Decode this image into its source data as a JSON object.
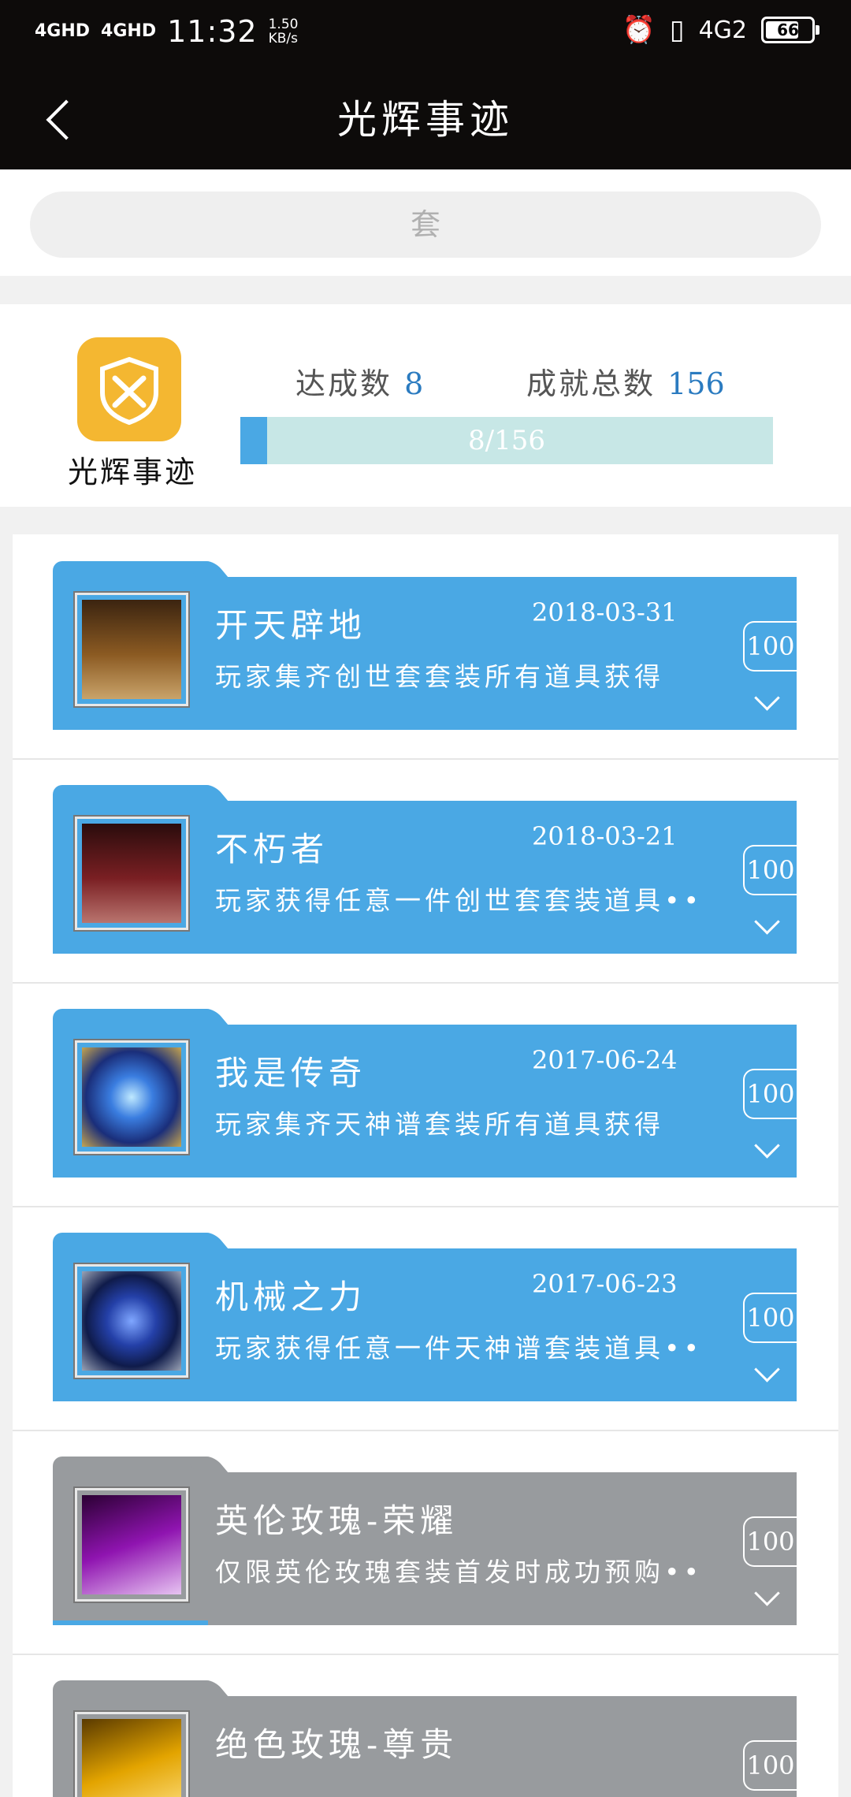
{
  "status_bar": {
    "signal1": "4GHD",
    "signal2": "4GHD",
    "time": "11:32",
    "speed_value": "1.50",
    "speed_unit": "KB/s",
    "network": "4G2",
    "battery": "66"
  },
  "header": {
    "title": "光辉事迹"
  },
  "search": {
    "placeholder": "套"
  },
  "summary": {
    "badge_label": "光辉事迹",
    "achieved_label": "达成数",
    "achieved_value": "8",
    "total_label": "成就总数",
    "total_value": "156",
    "progress_text": "8/156",
    "progress_fraction": 0.051
  },
  "achievements": [
    {
      "name": "开天辟地",
      "date": "2018-03-31",
      "desc": "玩家集齐创世套套装所有道具获得",
      "score": "100",
      "state": "active",
      "icon": "gold-armor-icon"
    },
    {
      "name": "不朽者",
      "date": "2018-03-21",
      "desc": "玩家获得任意一件创世套套装道具••",
      "score": "100",
      "state": "active",
      "icon": "red-armor-icon"
    },
    {
      "name": "我是传奇",
      "date": "2017-06-24",
      "desc": "玩家集齐天神谱套装所有道具获得",
      "score": "100",
      "state": "active",
      "icon": "blue-emblem-icon"
    },
    {
      "name": "机械之力",
      "date": "2017-06-23",
      "desc": "玩家获得任意一件天神谱套装道具••",
      "score": "100",
      "state": "active",
      "icon": "mech-emblem-icon"
    },
    {
      "name": "英伦玫瑰-荣耀",
      "date": "",
      "desc": "仅限英伦玫瑰套装首发时成功预购••",
      "score": "100",
      "state": "locked",
      "icon": "purple-rose-icon"
    },
    {
      "name": "绝色玫瑰-尊贵",
      "date": "",
      "desc": "",
      "score": "100",
      "state": "locked",
      "icon": "gold-rose-icon"
    }
  ],
  "colors": {
    "active": "#4aa8e4",
    "locked": "#989b9e",
    "accent": "#2b7bc0",
    "badge": "#f4b731"
  }
}
